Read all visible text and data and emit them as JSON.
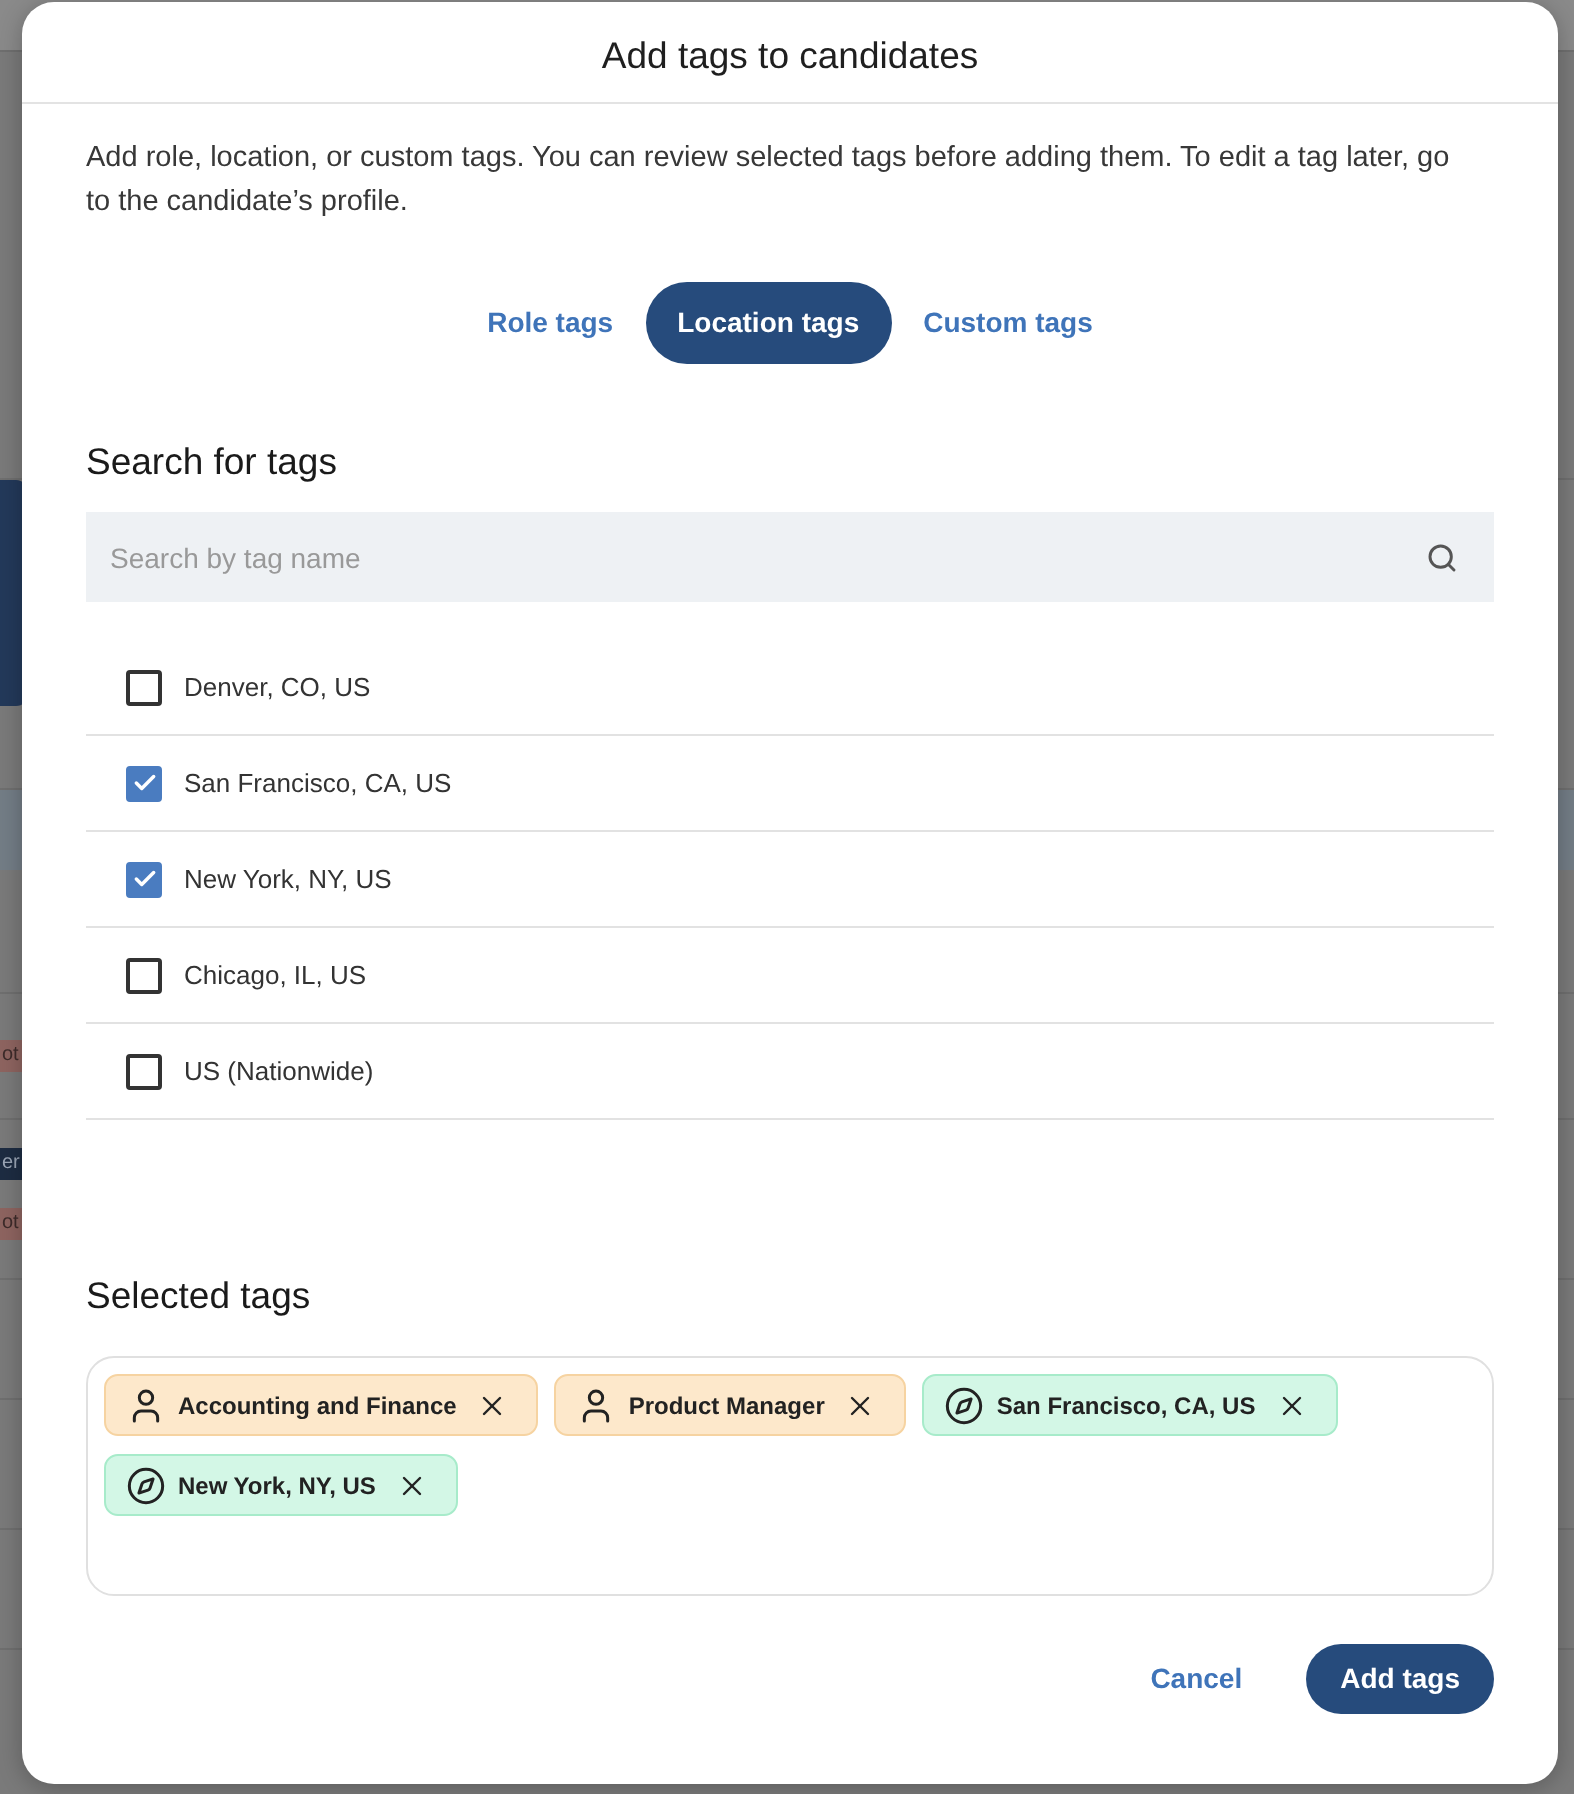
{
  "background_page": {
    "badges": [
      {
        "text": "ot",
        "color": "#8e6460"
      },
      {
        "text": "er",
        "color": "#1d2c42"
      },
      {
        "text": "ot",
        "color": "#8e6460"
      }
    ]
  },
  "dialog": {
    "title": "Add tags to candidates",
    "description": "Add role, location, or custom tags. You can review selected tags before adding them. To edit a tag later, go to the candidate’s profile."
  },
  "tabs": [
    {
      "label": "Role tags",
      "selected": false
    },
    {
      "label": "Location tags",
      "selected": true
    },
    {
      "label": "Custom tags",
      "selected": false
    }
  ],
  "search": {
    "heading": "Search for tags",
    "placeholder": "Search by tag name"
  },
  "options": [
    {
      "label": "Denver, CO, US",
      "checked": false
    },
    {
      "label": "San Francisco, CA, US",
      "checked": true
    },
    {
      "label": "New York, NY, US",
      "checked": true
    },
    {
      "label": "Chicago, IL, US",
      "checked": false
    },
    {
      "label": "US (Nationwide)",
      "checked": false
    }
  ],
  "selected_tags": {
    "heading": "Selected tags",
    "tags": [
      {
        "kind": "role",
        "label": "Accounting and Finance"
      },
      {
        "kind": "role",
        "label": "Product Manager"
      },
      {
        "kind": "location",
        "label": "San Francisco, CA, US"
      },
      {
        "kind": "location",
        "label": "New York, NY, US"
      }
    ]
  },
  "buttons": [
    {
      "kind": "secondary",
      "label": "Cancel"
    },
    {
      "kind": "primary",
      "label": "Add tags"
    }
  ]
}
